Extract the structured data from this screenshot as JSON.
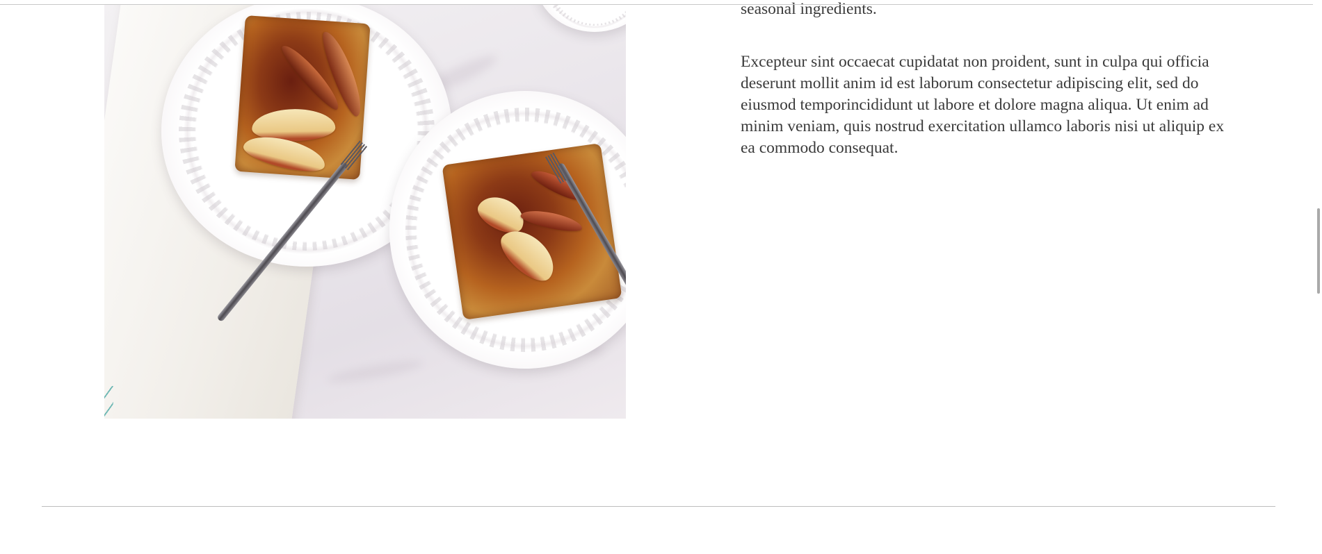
{
  "image": {
    "alt": "",
    "icon": "apple-cake-photo"
  },
  "content": {
    "paragraph_1_end": "seasonal ingredients.",
    "paragraph_2": "Excepteur sint occaecat cupidatat non proident, sunt in culpa qui officia deserunt mollit anim id est laborum consectetur adipiscing elit, sed do eiusmod temporincididunt ut labore et dolore magna aliqua. Ut enim ad minim veniam, quis nostrud exercitation ullamco laboris nisi ut aliquip ex ea commodo consequat."
  },
  "colors": {
    "text": "#3a3a3a",
    "divider": "#bdbdbd",
    "background": "#ffffff"
  }
}
